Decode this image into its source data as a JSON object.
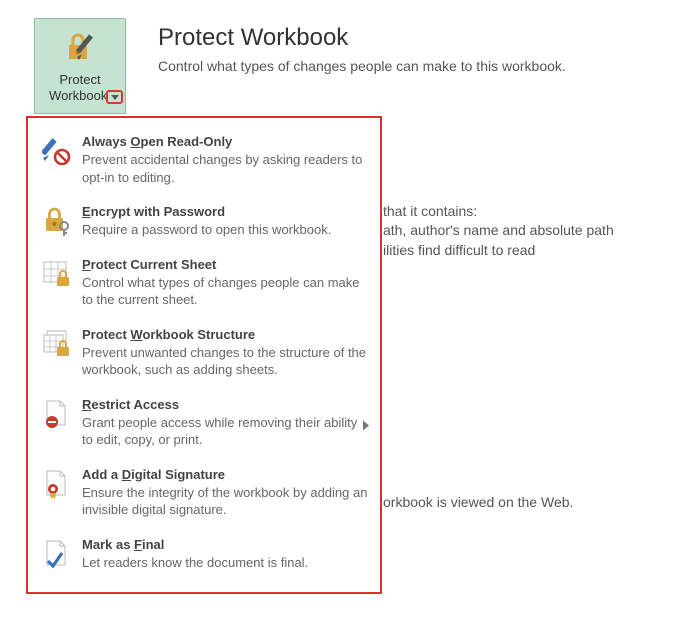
{
  "header": {
    "title": "Protect Workbook",
    "description": "Control what types of changes people can make to this workbook."
  },
  "button": {
    "label_line1": "Protect",
    "label_line2": "Workbook"
  },
  "background_fragments": {
    "line1": "that it contains:",
    "line2": "ath, author's name and absolute path",
    "line3": "ilities find difficult to read",
    "line4": "orkbook is viewed on the Web."
  },
  "menu": {
    "items": [
      {
        "title_pre": "Always ",
        "title_ul": "O",
        "title_post": "pen Read-Only",
        "desc": "Prevent accidental changes by asking readers to opt-in to editing."
      },
      {
        "title_pre": "",
        "title_ul": "E",
        "title_post": "ncrypt with Password",
        "desc": "Require a password to open this workbook."
      },
      {
        "title_pre": "",
        "title_ul": "P",
        "title_post": "rotect Current Sheet",
        "desc": "Control what types of changes people can make to the current sheet."
      },
      {
        "title_pre": "Protect ",
        "title_ul": "W",
        "title_post": "orkbook Structure",
        "desc": "Prevent unwanted changes to the structure of the workbook, such as adding sheets."
      },
      {
        "title_pre": "",
        "title_ul": "R",
        "title_post": "estrict Access",
        "desc": "Grant people access while removing their ability to edit, copy, or print."
      },
      {
        "title_pre": "Add a ",
        "title_ul": "D",
        "title_post": "igital Signature",
        "desc": "Ensure the integrity of the workbook by adding an invisible digital signature."
      },
      {
        "title_pre": "Mark as ",
        "title_ul": "F",
        "title_post": "inal",
        "desc": "Let readers know the document is final."
      }
    ]
  }
}
